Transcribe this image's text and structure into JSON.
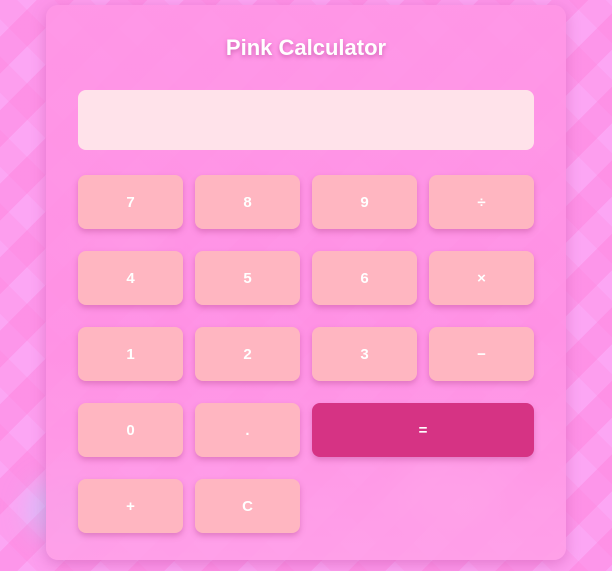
{
  "app": {
    "title": "Pink Calculator"
  },
  "display": {
    "value": "",
    "placeholder": ""
  },
  "keys": {
    "seven": "7",
    "eight": "8",
    "nine": "9",
    "divide": "÷",
    "four": "4",
    "five": "5",
    "six": "6",
    "multiply": "×",
    "one": "1",
    "two": "2",
    "three": "3",
    "subtract": "−",
    "zero": "0",
    "decimal": ".",
    "equals": "=",
    "add": "+",
    "clear": "C"
  },
  "colors": {
    "background": "#fca6f4",
    "panel": "#ff96e6",
    "display": "#ffe2ea",
    "key": "#ffb6c1",
    "equals_key": "#d63384",
    "key_text": "#ffffff"
  }
}
